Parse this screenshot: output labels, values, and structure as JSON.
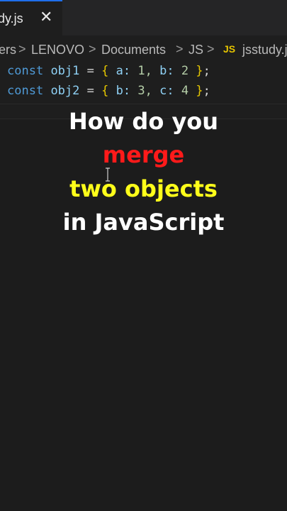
{
  "tab": {
    "label": "dy.js",
    "close": "✕"
  },
  "breadcrumb": {
    "items": [
      "ers",
      "LENOVO",
      "Documents",
      "JS"
    ],
    "separator": ">",
    "file_icon": "JS",
    "file": "jsstudy.js"
  },
  "code": {
    "line1": {
      "kw": "const",
      "name": "obj1",
      "eq": "=",
      "open": "{",
      "p1": "a:",
      "v1": "1,",
      "p2": "b:",
      "v2": "2",
      "close": "}",
      "semi": ";"
    },
    "line2": {
      "kw": "const",
      "name": "obj2",
      "eq": "=",
      "open": "{",
      "p1": "b:",
      "v1": "3,",
      "p2": "c:",
      "v2": "4",
      "close": "}",
      "semi": ";"
    }
  },
  "headline": {
    "line1": "How do you",
    "line2": "merge",
    "line3": "two objects",
    "line4": "in JavaScript"
  },
  "colors": {
    "line1": "#ffffff",
    "line2": "#ff1a1a",
    "line3": "#ffff1a",
    "line4": "#ffffff",
    "background": "#1c1c1c"
  }
}
